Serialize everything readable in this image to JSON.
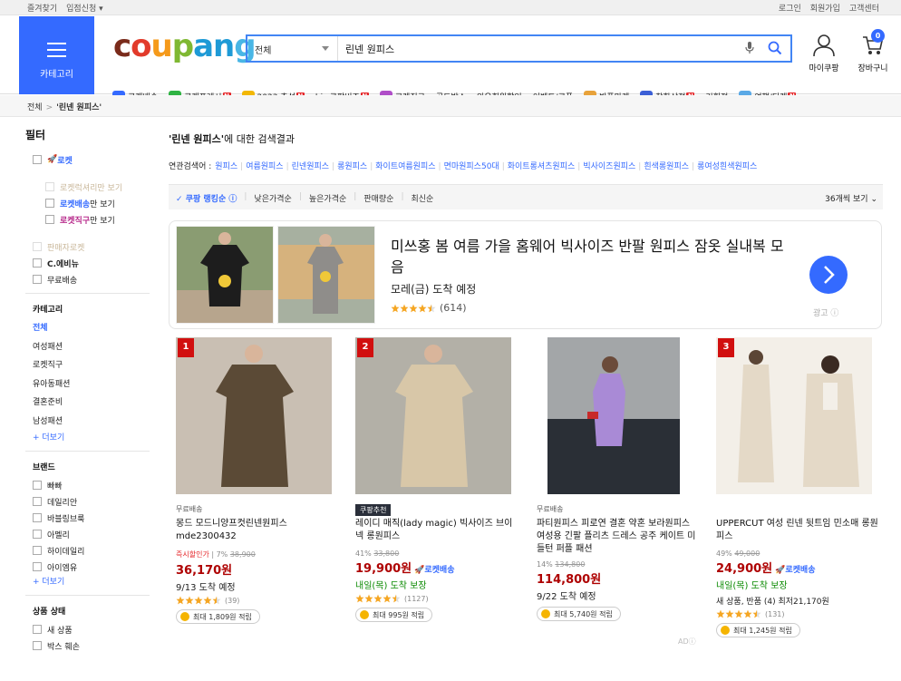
{
  "topbar": {
    "favorites": "즐겨찾기",
    "seller": "입점신청",
    "login": "로그인",
    "signup": "회원가입",
    "support": "고객센터"
  },
  "header": {
    "category_label": "카테고리",
    "logo": "coupang",
    "search_scope": "전체",
    "search_value": "린넨 원피스",
    "mypage": "마이쿠팡",
    "cart": "장바구니",
    "cart_count": "0"
  },
  "quicknav": [
    {
      "label": "로켓배송",
      "color": "#346aff",
      "new": false
    },
    {
      "label": "로켓프레시",
      "color": "#2fb343",
      "new": true
    },
    {
      "label": "2023 추석",
      "color": "#f2b705",
      "new": true
    },
    {
      "label": "biz 쿠팡비즈",
      "color": "#ffffff",
      "new": true
    },
    {
      "label": "로켓직구",
      "color": "#b04ec8",
      "new": false
    },
    {
      "label": "골드박스",
      "color": "#ffffff",
      "new": false
    },
    {
      "label": "와우회원할인",
      "color": "#ffffff",
      "new": false
    },
    {
      "label": "이벤트/쿠폰",
      "color": "#ffffff",
      "new": false
    },
    {
      "label": "반품마켓",
      "color": "#e8a23a",
      "new": false
    },
    {
      "label": "착한상점",
      "color": "#3b5fd6",
      "new": true
    },
    {
      "label": "기획전",
      "color": "#ffffff",
      "new": false
    },
    {
      "label": "여행/티켓",
      "color": "#5aa9e6",
      "new": true
    }
  ],
  "breadcrumb": {
    "root": "전체",
    "current": "'린넨 원피스'"
  },
  "sidebar": {
    "filter_title": "필터",
    "rocket": "로켓",
    "rocket_luxury": "로켓럭셔리만 보기",
    "rocket_delivery": "로켓배송",
    "rocket_delivery_suffix": "만 보기",
    "rocket_direct": "로켓직구",
    "rocket_direct_suffix": "만 보기",
    "sameday": "판매자로켓",
    "evening": "C.에비뉴",
    "free_shipping": "무료배송",
    "category_title": "카테고리",
    "categories": [
      "전체",
      "여성패션",
      "로켓직구",
      "유아동패션",
      "결혼준비",
      "남성패션"
    ],
    "more": "+ 더보기",
    "brand_title": "브랜드",
    "brands": [
      "빠빠",
      "데일리안",
      "바블링브룩",
      "아멜리",
      "하이데일리",
      "아이엠유"
    ],
    "brand_more": "+ 더보기",
    "condition_title": "상품 상태",
    "conditions": [
      "새 상품",
      "박스 훼손"
    ]
  },
  "main": {
    "result_query": "'린넨 원피스'",
    "result_suffix": "에 대한 검색결과",
    "related_label": "연관검색어 :",
    "related": [
      "원피스",
      "여름원피스",
      "린넨원피스",
      "롱원피스",
      "화이트여름원피스",
      "면마원피스50대",
      "화이트롱셔츠원피스",
      "빅사이즈원피스",
      "흰색롱원피스",
      "롱여성흰색원피스"
    ],
    "sort_options": [
      "쿠팡 랭킹순",
      "낮은가격순",
      "높은가격순",
      "판매량순",
      "최신순"
    ],
    "sort_count": "36개씩 보기"
  },
  "ad": {
    "title": "미쓰홍 봄 여름 가을 홈웨어 빅사이즈 반팔 원피스 잠옷 실내복 모음",
    "arrival": "모레(금) 도착 예정",
    "rating": 4.5,
    "reviews": "(614)",
    "label": "광고"
  },
  "products": [
    {
      "rank": "1",
      "tag": "무료배송",
      "name": "몽드 모드니양프컷린넨원피스 mde2300432",
      "disc_label": "즉시할인가",
      "disc_pct": "7%",
      "orig": "38,900",
      "price": "36,170원",
      "rocket": "",
      "arrival": "9/13 도착 예정",
      "reviews": "(39)",
      "cash": "최대 1,809원 적립",
      "color": "#5b4a36"
    },
    {
      "rank": "2",
      "tag": "쿠팡추천",
      "name": "레이디 매직(lady magic) 빅사이즈 브이넥 롱원피스",
      "disc_pct": "41%",
      "orig": "33,800",
      "price": "19,900원",
      "rocket": "로켓배송",
      "arrival": "내일(목) 도착 보장",
      "reviews": "(1127)",
      "cash": "최대 995원 적립",
      "color": "#d8c7a8"
    },
    {
      "rank": "",
      "tag": "무료배송",
      "name": "파티원피스 피로연 결혼 약혼 보라원피스 여성용 긴팔 플리츠 드레스 공주 케이트 미들턴 퍼플 패션",
      "disc_pct": "14%",
      "orig": "134,800",
      "price": "114,800원",
      "rocket": "",
      "arrival": "9/22 도착 예정",
      "reviews": "",
      "cash": "최대 5,740원 적립",
      "ad": "AD",
      "color": "#a98ad6"
    },
    {
      "rank": "3",
      "tag": "",
      "name": "UPPERCUT 여성 린넨 뒷트임 민소매 롱원피스",
      "disc_pct": "49%",
      "orig": "49,000",
      "price": "24,900원",
      "rocket": "로켓배송",
      "arrival": "내일(목) 도착 보장",
      "extra": "새 상품, 반품 (4) 최저21,170원",
      "reviews": "(131)",
      "cash": "최대 1,245원 적립",
      "color": "#e4d9c7"
    }
  ]
}
